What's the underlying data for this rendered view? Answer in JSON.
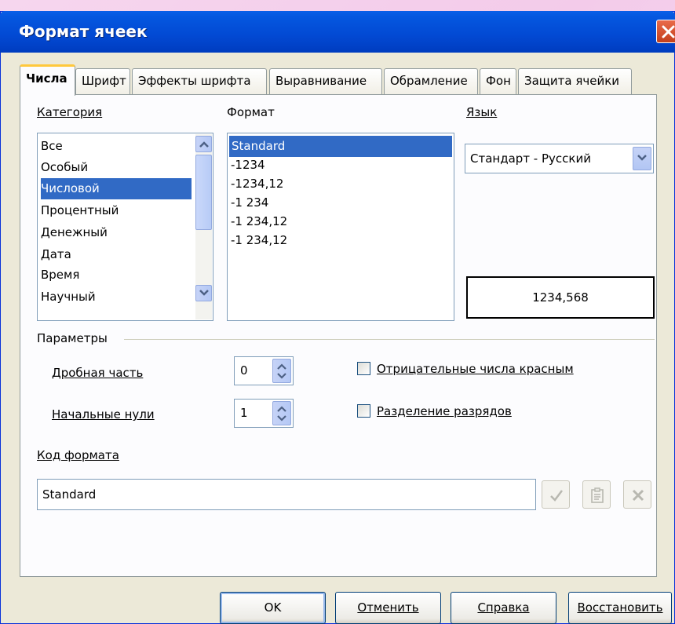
{
  "window": {
    "title": "Формат ячеек"
  },
  "tabs": [
    {
      "label": "Числа",
      "active": true
    },
    {
      "label": "Шрифт",
      "active": false
    },
    {
      "label": "Эффекты шрифта",
      "active": false
    },
    {
      "label": "Выравнивание",
      "active": false
    },
    {
      "label": "Обрамление",
      "active": false
    },
    {
      "label": "Фон",
      "active": false
    },
    {
      "label": "Защита ячейки",
      "active": false
    }
  ],
  "category": {
    "label": "Категория",
    "items": [
      "Все",
      "Особый",
      "Числовой",
      "Процентный",
      "Денежный",
      "Дата",
      "Время",
      "Научный"
    ],
    "selected": "Числовой"
  },
  "format": {
    "label": "Формат",
    "items": [
      "Standard",
      "-1234",
      "-1234,12",
      "-1 234",
      "-1 234,12",
      "-1 234,12"
    ],
    "selected": "Standard"
  },
  "language": {
    "label": "Язык",
    "value": "Стандарт - Русский"
  },
  "preview": {
    "value": "1234,568"
  },
  "params": {
    "label": "Параметры",
    "decimal_label": "Дробная часть",
    "decimal_value": "0",
    "leading_label": "Начальные нули",
    "leading_value": "1",
    "negative_red_label": "Отрицательные числа красным",
    "negative_red_checked": false,
    "thousands_label": "Разделение разрядов",
    "thousands_checked": false
  },
  "format_code": {
    "label": "Код формата",
    "value": "Standard"
  },
  "buttons": {
    "ok": "OK",
    "cancel": "Отменить",
    "help": "Справка",
    "reset": "Восстановить"
  },
  "colors": {
    "titlebar": "#0249d3",
    "selection": "#316ac5",
    "dialog_bg": "#ece9d8"
  }
}
